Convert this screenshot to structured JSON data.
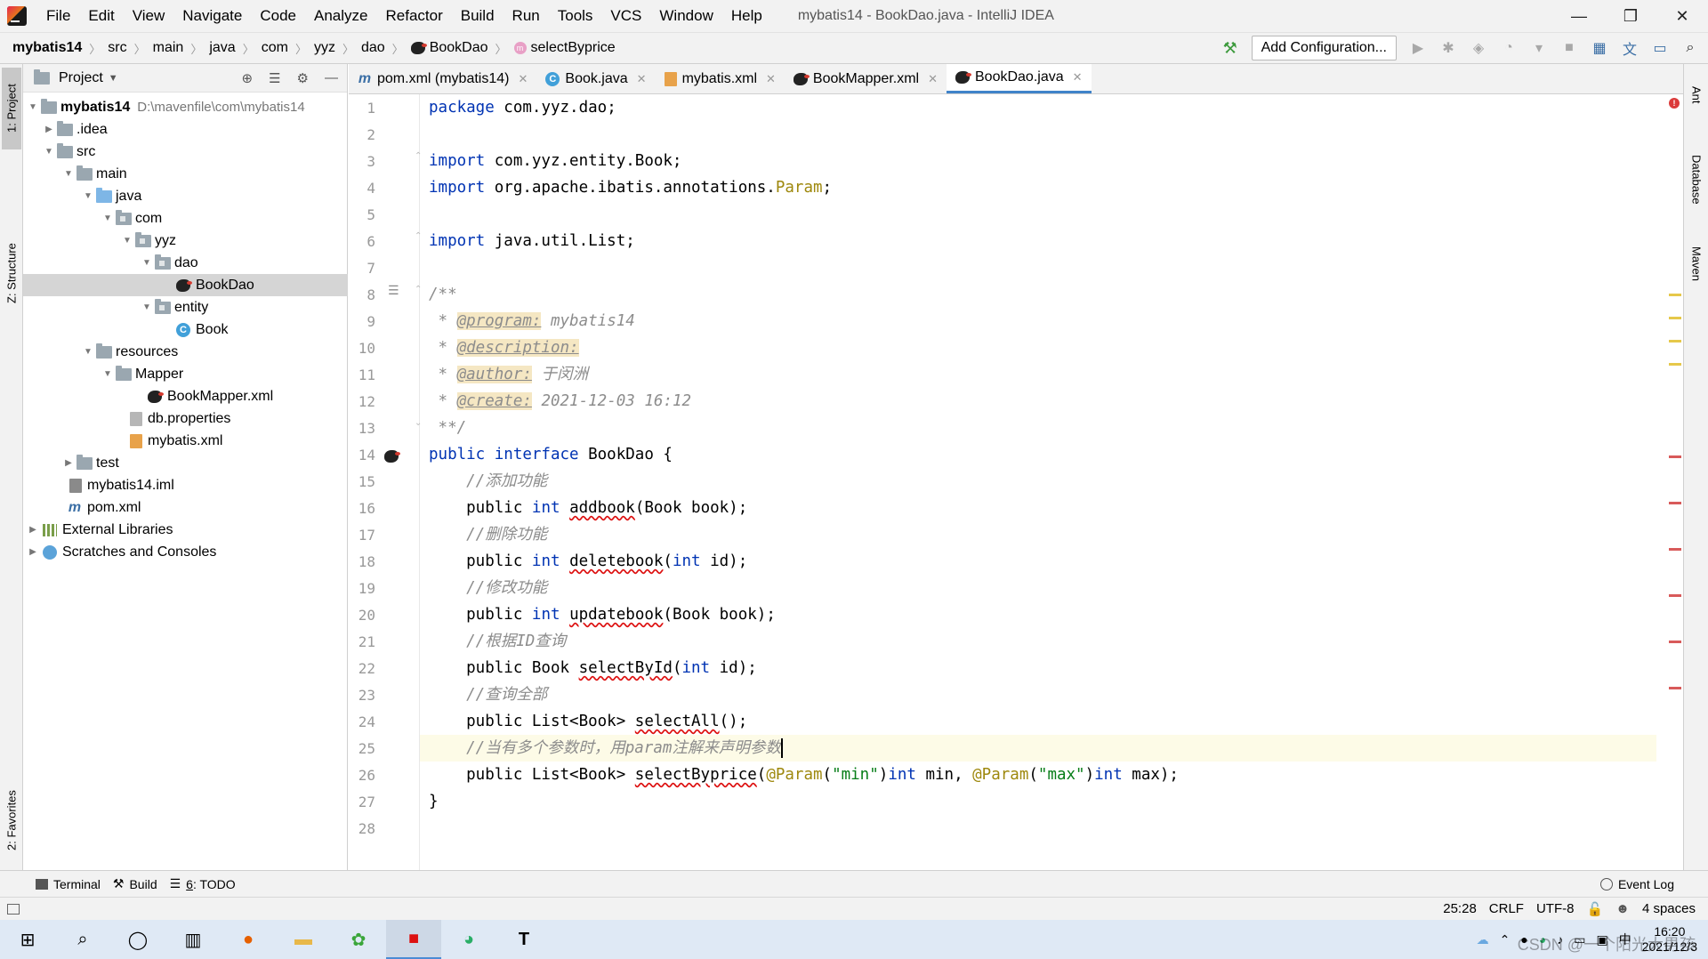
{
  "menubar": {
    "items": [
      "File",
      "Edit",
      "View",
      "Navigate",
      "Code",
      "Analyze",
      "Refactor",
      "Build",
      "Run",
      "Tools",
      "VCS",
      "Window",
      "Help"
    ],
    "window_title": "mybatis14 - BookDao.java - IntelliJ IDEA",
    "controls": {
      "minimize": "—",
      "restore": "❐",
      "close": "✕"
    }
  },
  "navbar": {
    "crumbs": [
      "mybatis14",
      "src",
      "main",
      "java",
      "com",
      "yyz",
      "dao",
      "BookDao",
      "selectByprice"
    ],
    "add_config": "Add Configuration..."
  },
  "left_strip": {
    "project": "1: Project",
    "structure": "Z: Structure",
    "favorites": "2: Favorites"
  },
  "right_strip": {
    "ant": "Ant",
    "database": "Database",
    "maven": "Maven"
  },
  "project_panel": {
    "title": "Project",
    "tree": [
      {
        "label": "mybatis14",
        "hint": "D:\\mavenfile\\com\\mybatis14"
      },
      {
        "label": ".idea"
      },
      {
        "label": "src"
      },
      {
        "label": "main"
      },
      {
        "label": "java"
      },
      {
        "label": "com"
      },
      {
        "label": "yyz"
      },
      {
        "label": "dao"
      },
      {
        "label": "BookDao"
      },
      {
        "label": "entity"
      },
      {
        "label": "Book"
      },
      {
        "label": "resources"
      },
      {
        "label": "Mapper"
      },
      {
        "label": "BookMapper.xml"
      },
      {
        "label": "db.properties"
      },
      {
        "label": "mybatis.xml"
      },
      {
        "label": "test"
      },
      {
        "label": "mybatis14.iml"
      },
      {
        "label": "pom.xml"
      },
      {
        "label": "External Libraries"
      },
      {
        "label": "Scratches and Consoles"
      }
    ]
  },
  "editor_tabs": [
    {
      "label": "pom.xml (mybatis14)",
      "active": false
    },
    {
      "label": "Book.java",
      "active": false
    },
    {
      "label": "mybatis.xml",
      "active": false
    },
    {
      "label": "BookMapper.xml",
      "active": false
    },
    {
      "label": "BookDao.java",
      "active": true
    }
  ],
  "editor": {
    "line_numbers": [
      "1",
      "2",
      "3",
      "4",
      "5",
      "6",
      "7",
      "8",
      "9",
      "10",
      "11",
      "12",
      "13",
      "14",
      "15",
      "16",
      "17",
      "18",
      "19",
      "20",
      "21",
      "22",
      "23",
      "24",
      "25",
      "26",
      "27",
      "28"
    ],
    "code": {
      "l1_kw": "package",
      "l1_rest": " com.yyz.dao;",
      "l3_kw": "import",
      "l3_rest": " com.yyz.entity.Book;",
      "l4_kw": "import",
      "l4_rest": " org.apache.ibatis.annotations.",
      "l4_ann": "Param",
      "l4_end": ";",
      "l6_kw": "import",
      "l6_rest": " java.util.List;",
      "l8": "/**",
      "l9_pre": " * ",
      "l9_tag": "@program:",
      "l9_val": " mybatis14",
      "l10_pre": " * ",
      "l10_tag": "@description:",
      "l11_pre": " * ",
      "l11_tag": "@author:",
      "l11_val": " 于闵洲",
      "l12_pre": " * ",
      "l12_tag": "@create:",
      "l12_val": " 2021-12-03 16:12",
      "l13": " **/",
      "l14_kw1": "public",
      "l14_kw2": " interface",
      "l14_rest": " BookDao {",
      "l15": "    //添加功能",
      "l16_pre": "    public ",
      "l16_kw": "int",
      "l16_sp": " ",
      "l16_name": "addbook",
      "l16_rest": "(Book book);",
      "l17": "    //删除功能",
      "l18_pre": "    public ",
      "l18_kw": "int",
      "l18_sp": " ",
      "l18_name": "deletebook",
      "l18_p1": "(",
      "l18_kw2": "int",
      "l18_rest": " id);",
      "l19": "    //修改功能",
      "l20_pre": "    public ",
      "l20_kw": "int",
      "l20_sp": " ",
      "l20_name": "updatebook",
      "l20_rest": "(Book book);",
      "l21": "    //根据ID查询",
      "l22_pre": "    public Book ",
      "l22_name": "selectById",
      "l22_p1": "(",
      "l22_kw": "int",
      "l22_rest": " id);",
      "l23": "    //查询全部",
      "l24_pre": "    public List<Book> ",
      "l24_name": "selectAll",
      "l24_rest": "();",
      "l25": "    //当有多个参数时，用param注解来声明参数",
      "l26_pre": "    public List<Book> ",
      "l26_name": "selectByprice",
      "l26_p1": "(",
      "l26_ann1": "@Param",
      "l26_p2": "(",
      "l26_s1": "\"min\"",
      "l26_p3": ")",
      "l26_kw1": "int",
      "l26_m1": " min, ",
      "l26_ann2": "@Param",
      "l26_p4": "(",
      "l26_s2": "\"max\"",
      "l26_p5": ")",
      "l26_kw2": "int",
      "l26_rest": " max);",
      "l27": "}"
    }
  },
  "bottom_tools": {
    "terminal": "Terminal",
    "build": "Build",
    "todo_num": "6",
    "todo_label": ": TODO",
    "event_log": "Event Log"
  },
  "statusbar": {
    "position": "25:28",
    "line_sep": "CRLF",
    "encoding": "UTF-8",
    "indent": "4 spaces"
  },
  "taskbar": {
    "time": "16:20",
    "date": "2021/12/3",
    "watermark": "CSDN @一个阳光大男孩"
  },
  "colors": {
    "keyword": "#0033b3",
    "comment": "#8c8c8c",
    "annotation": "#9e880d",
    "string": "#067d17",
    "tab_accent": "#4083c9"
  }
}
